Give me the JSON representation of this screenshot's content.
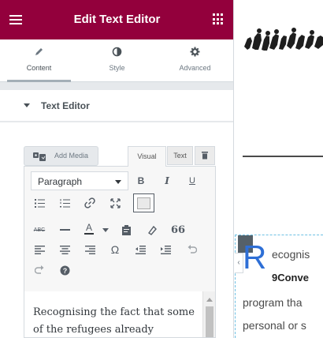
{
  "panel": {
    "title": "Edit Text Editor",
    "header_color": "#93003c"
  },
  "tabs": [
    {
      "label": "Content",
      "icon": "pencil-icon",
      "active": true
    },
    {
      "label": "Style",
      "icon": "half-circle-icon",
      "active": false
    },
    {
      "label": "Advanced",
      "icon": "gear-icon",
      "active": false
    }
  ],
  "section": {
    "title": "Text Editor"
  },
  "media": {
    "add_label": "Add Media"
  },
  "editor_tabs": {
    "visual": "Visual",
    "text": "Text"
  },
  "toolbar": {
    "format_value": "Paragraph",
    "bold": "B",
    "italic": "I",
    "underline": "U",
    "text_color_letter": "A",
    "special_char": "Ω",
    "quote": "66"
  },
  "editor": {
    "content": "Recognising the fact that some of the refugees already"
  },
  "preview": {
    "drop_cap": "R",
    "line1": "ecognis",
    "line2": "9Conve",
    "line3": "program tha",
    "line4": "personal or s",
    "accent_color": "#2e6fd6"
  }
}
